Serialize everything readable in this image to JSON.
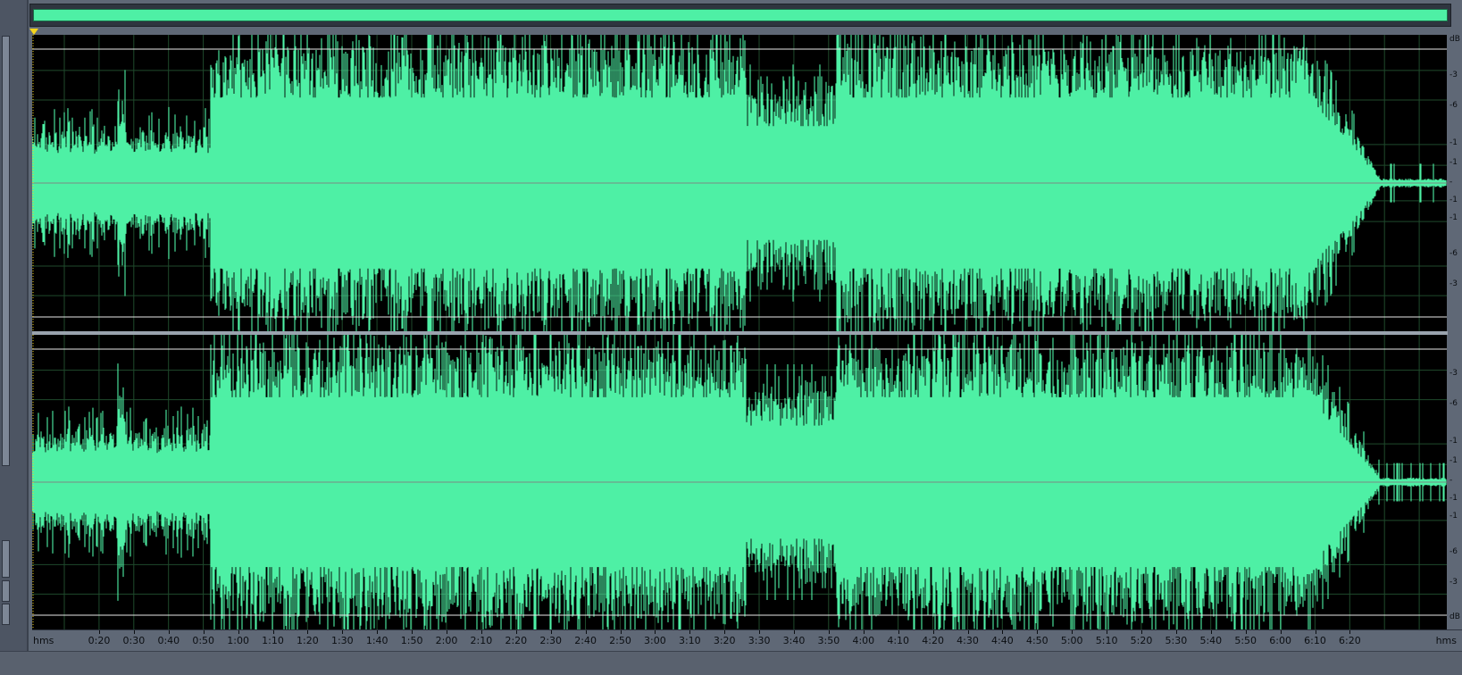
{
  "colors": {
    "waveform": "#4ef0a5",
    "background": "#000000",
    "grid": "#1f4a2c",
    "clip_line": "#e8e8e8",
    "center_line": "#7a8a82",
    "marker": "#f4d51b"
  },
  "time_ruler": {
    "unit_left": "hms",
    "unit_right": "hms",
    "labels": [
      "0:20",
      "0:30",
      "0:40",
      "0:50",
      "1:00",
      "1:10",
      "1:20",
      "1:30",
      "1:40",
      "1:50",
      "2:00",
      "2:10",
      "2:20",
      "2:30",
      "2:40",
      "2:50",
      "3:00",
      "3:10",
      "3:20",
      "3:30",
      "3:40",
      "3:50",
      "4:00",
      "4:10",
      "4:20",
      "4:30",
      "4:40",
      "4:50",
      "5:00",
      "5:10",
      "5:20",
      "5:30",
      "5:40",
      "5:50",
      "6:00",
      "6:10",
      "6:20"
    ]
  },
  "db_ruler": {
    "top_unit": "dB",
    "bottom_unit": "dB",
    "channel_labels": [
      "-3",
      "-6",
      "-1",
      "-1",
      "-",
      "-1",
      "-1",
      "-6",
      "-3"
    ]
  },
  "channels": [
    "left",
    "right"
  ],
  "icons": {
    "start_marker_top": "triangle-down-icon",
    "start_marker_bottom": "triangle-up-icon"
  }
}
